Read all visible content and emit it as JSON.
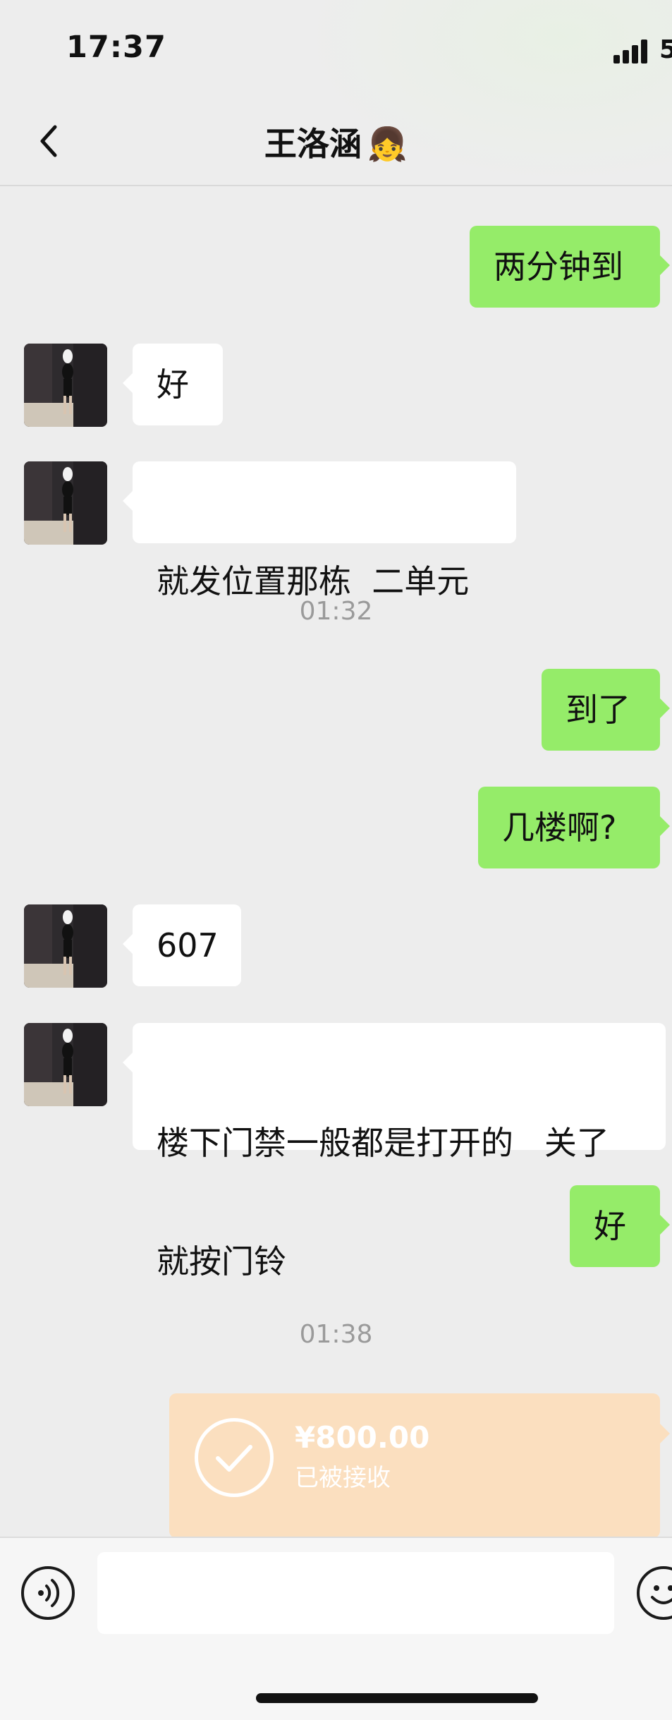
{
  "status_bar": {
    "time": "17:37",
    "battery_partial": "5"
  },
  "header": {
    "contact_name": "王洛涵",
    "contact_emoji": "👧"
  },
  "messages": [
    {
      "side": "out",
      "text": "两分钟到"
    },
    {
      "side": "in",
      "text": "好"
    },
    {
      "side": "in",
      "text": "就发位置那栋  二单元"
    },
    {
      "timestamp": "01:32"
    },
    {
      "side": "out",
      "text": "到了"
    },
    {
      "side": "out",
      "text": "几楼啊?"
    },
    {
      "side": "in",
      "text": "607"
    },
    {
      "side": "in",
      "text_line1": "楼下门禁一般都是打开的   关了",
      "text_line2": "就按门铃"
    },
    {
      "side": "out",
      "text": "好"
    },
    {
      "timestamp": "01:38"
    }
  ],
  "transfer": {
    "amount": "¥800.00",
    "status": "已被接收"
  },
  "colors": {
    "bubble_out": "#95ec69",
    "bubble_in": "#ffffff",
    "background": "#ededed",
    "transfer_bg": "#fbdfbf"
  },
  "icons": {
    "back": "chevron-left-icon",
    "voice": "voice-icon",
    "emoji": "smiley-icon",
    "check": "checkmark-icon"
  }
}
